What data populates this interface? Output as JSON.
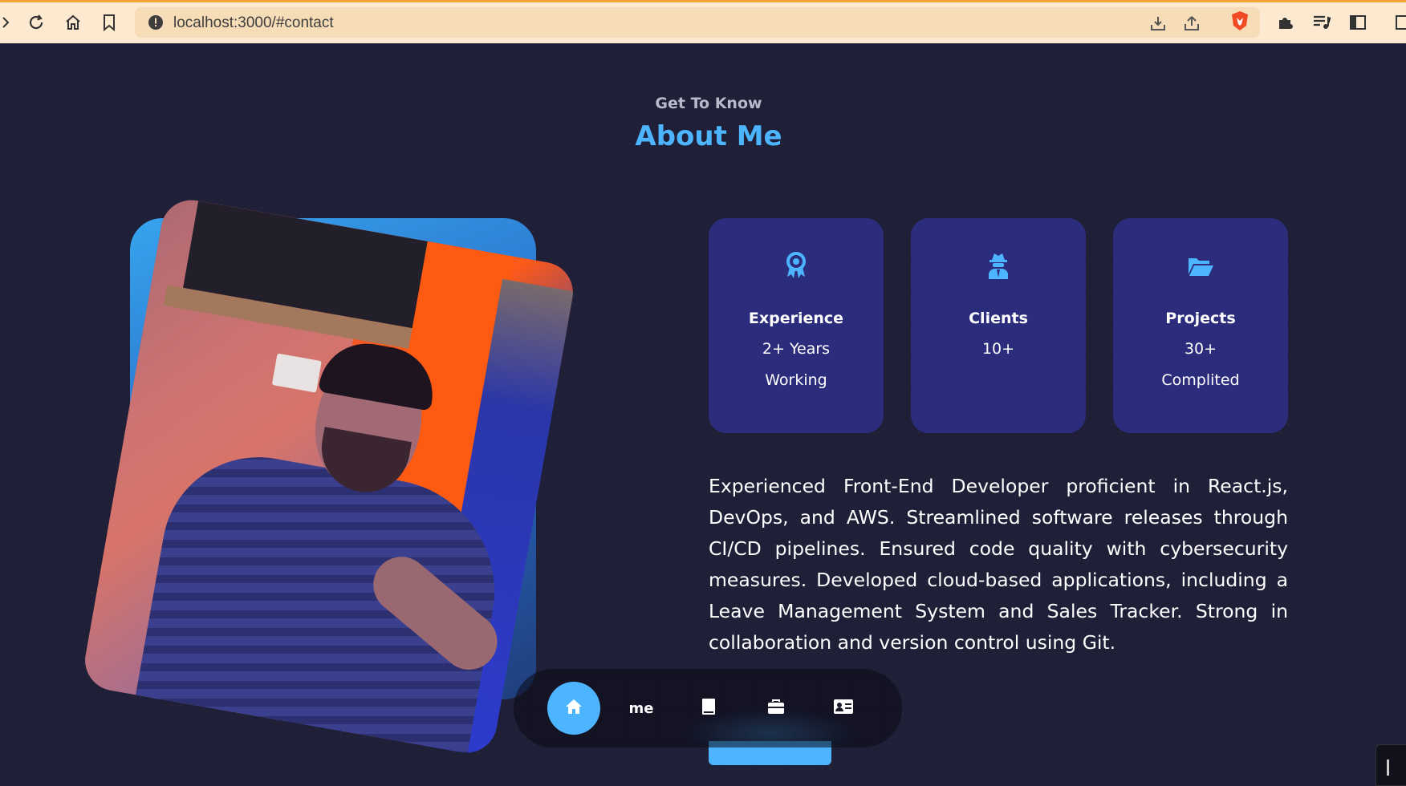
{
  "browser": {
    "url": "localhost:3000/#contact",
    "accent_color": "#f4a336"
  },
  "section": {
    "subtitle": "Get To Know",
    "title": "About Me"
  },
  "cards": [
    {
      "icon": "award-icon",
      "label": "Experience",
      "line1": "2+ Years",
      "line2": "Working"
    },
    {
      "icon": "user-secret-icon",
      "label": "Clients",
      "line1": "10+",
      "line2": ""
    },
    {
      "icon": "folder-open-icon",
      "label": "Projects",
      "line1": "30+",
      "line2": "Complited"
    }
  ],
  "about_text": "Experienced Front-End Developer proficient in React.js, DevOps, and AWS. Streamlined software releases through CI/CD pipelines. Ensured code quality with cybersecurity measures. Developed cloud-based applications, including a Leave Management System and Sales Tracker. Strong in collaboration and version control using Git.",
  "floating_nav": {
    "items": [
      "home-icon",
      "me",
      "book-icon",
      "briefcase-icon",
      "contact-card-icon"
    ],
    "me_label": "me",
    "active": "home-icon"
  },
  "colors": {
    "background": "#1f1f38",
    "card": "#2c2c7c",
    "primary": "#4db5ff"
  }
}
